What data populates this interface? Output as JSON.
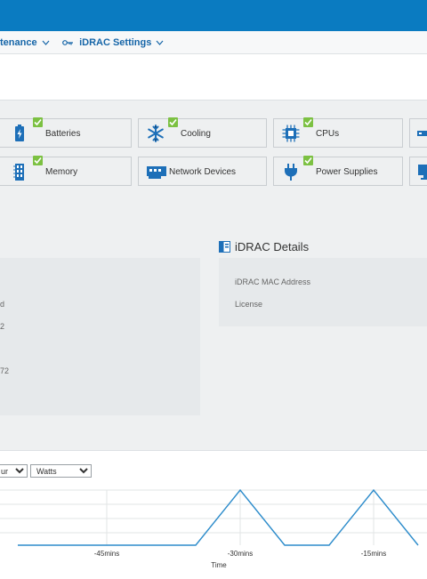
{
  "nav": {
    "maintenance_label": "tenance",
    "idrac_settings_label": "iDRAC Settings"
  },
  "tiles": [
    {
      "label": "Batteries",
      "icon": "battery-icon",
      "status": "ok"
    },
    {
      "label": "Cooling",
      "icon": "snowflake-icon",
      "status": "ok"
    },
    {
      "label": "CPUs",
      "icon": "cpu-icon",
      "status": "ok"
    },
    {
      "label": "",
      "icon": "server-icon",
      "status": ""
    },
    {
      "label": "Memory",
      "icon": "memory-icon",
      "status": "ok"
    },
    {
      "label": "Network Devices",
      "icon": "network-card-icon",
      "status": ""
    },
    {
      "label": "Power Supplies",
      "icon": "power-plug-icon",
      "status": "ok"
    },
    {
      "label": "",
      "icon": "monitor-icon",
      "status": ""
    }
  ],
  "system_panel": {
    "values": [
      "d",
      "2",
      "72"
    ]
  },
  "idrac_details": {
    "title": "iDRAC Details",
    "fields": [
      "iDRAC MAC Address",
      "License"
    ]
  },
  "power_chart": {
    "range_select": "ur",
    "unit_select": "Watts",
    "xlabel": "Time"
  },
  "chart_data": {
    "type": "line",
    "title": "",
    "xlabel": "Time",
    "ylabel": "",
    "x_ticks": [
      "-45mins",
      "-30mins",
      "-15mins"
    ],
    "x": [
      -55,
      -40,
      -35,
      -30,
      -25,
      -20,
      -15,
      -10
    ],
    "series": [
      {
        "values": [
          0,
          0,
          0,
          1,
          0,
          0,
          1,
          0
        ]
      }
    ],
    "grid": true,
    "color": "#2d8ccb"
  },
  "colors": {
    "brand": "#0a7bc1",
    "ok": "#7cc142",
    "line": "#2d8ccb"
  }
}
